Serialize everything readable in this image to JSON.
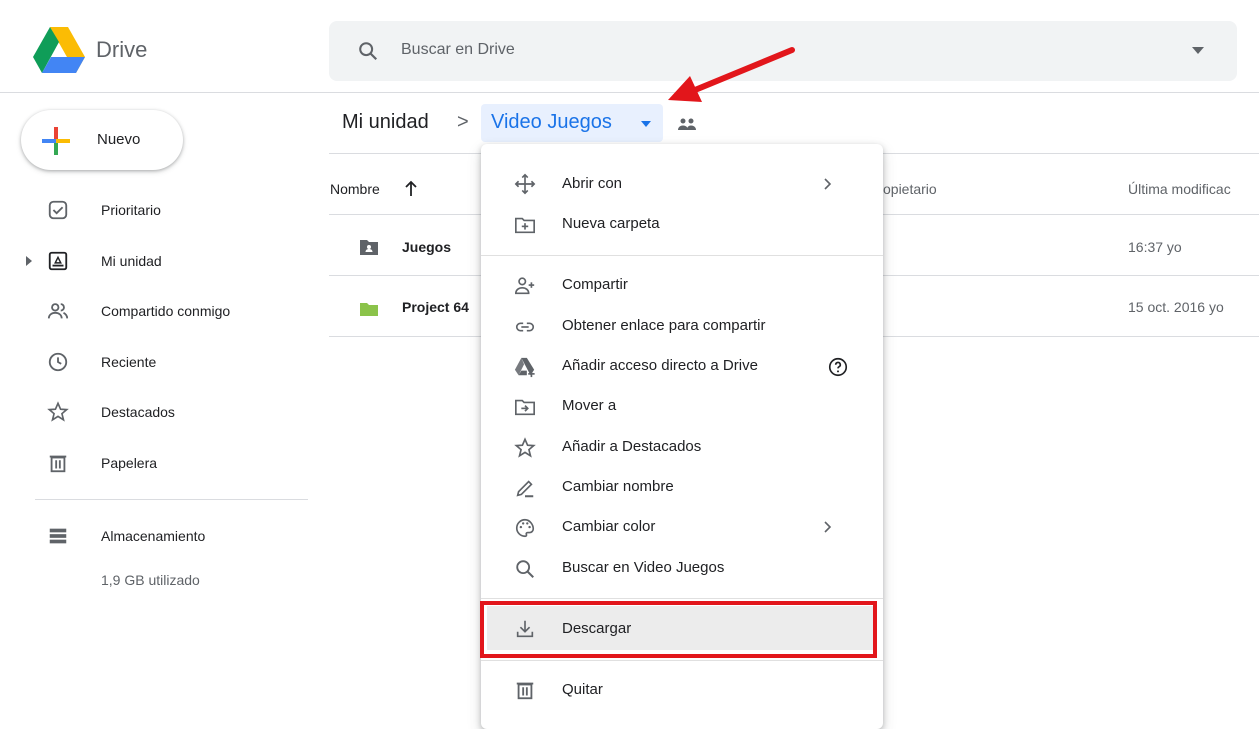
{
  "app": {
    "name": "Drive"
  },
  "search": {
    "placeholder": "Buscar en Drive"
  },
  "sidebar": {
    "new_label": "Nuevo",
    "items": [
      {
        "label": "Prioritario",
        "icon": "check-square-icon"
      },
      {
        "label": "Mi unidad",
        "icon": "drive-folder-icon"
      },
      {
        "label": "Compartido conmigo",
        "icon": "people-icon"
      },
      {
        "label": "Reciente",
        "icon": "clock-icon"
      },
      {
        "label": "Destacados",
        "icon": "star-icon"
      },
      {
        "label": "Papelera",
        "icon": "trash-icon"
      }
    ],
    "storage": {
      "label": "Almacenamiento",
      "used": "1,9 GB utilizado"
    }
  },
  "breadcrumb": {
    "root": "Mi unidad",
    "separator": ">",
    "current": "Video Juegos"
  },
  "file_list": {
    "columns": {
      "name": "Nombre",
      "owner": "opietario",
      "modified": "Última modificac"
    },
    "rows": [
      {
        "name": "Juegos",
        "icon": "shared-folder-icon",
        "modified": "16:37 yo"
      },
      {
        "name": "Project 64",
        "icon": "folder-icon",
        "modified": "15 oct. 2016 yo"
      }
    ]
  },
  "context_menu": {
    "items": [
      {
        "label": "Abrir con",
        "icon": "move-arrows-icon",
        "submenu": true
      },
      {
        "label": "Nueva carpeta",
        "icon": "new-folder-icon"
      },
      {
        "label": "Compartir",
        "icon": "add-person-icon"
      },
      {
        "label": "Obtener enlace para compartir",
        "icon": "link-icon"
      },
      {
        "label": "Añadir acceso directo a Drive",
        "icon": "drive-shortcut-icon",
        "help": true
      },
      {
        "label": "Mover a",
        "icon": "move-folder-icon"
      },
      {
        "label": "Añadir a Destacados",
        "icon": "star-icon"
      },
      {
        "label": "Cambiar nombre",
        "icon": "pencil-icon"
      },
      {
        "label": "Cambiar color",
        "icon": "palette-icon",
        "submenu": true
      },
      {
        "label": "Buscar en Video Juegos",
        "icon": "search-icon"
      },
      {
        "label": "Descargar",
        "icon": "download-icon",
        "highlighted": true
      },
      {
        "label": "Quitar",
        "icon": "trash-icon"
      }
    ]
  },
  "colors": {
    "accent_blue": "#1a73e8",
    "breadcrumb_bg": "#e8f0fe",
    "annotation_red": "#e2161b",
    "project_folder_green": "#8bc34a"
  }
}
